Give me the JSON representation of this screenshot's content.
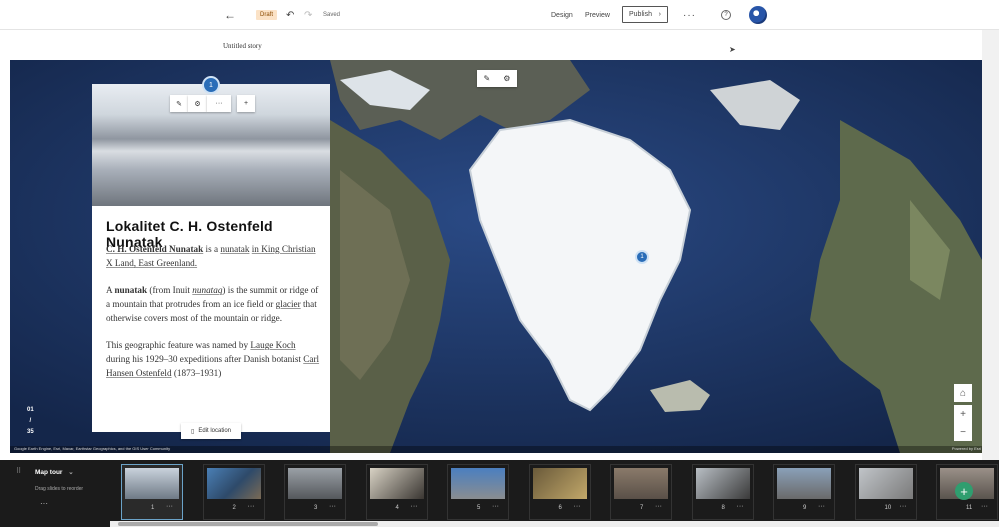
{
  "topbar": {
    "back_icon": "←",
    "status_badge": "Draft",
    "undo_icon": "↶",
    "redo_icon": "↷",
    "saved_label": "Saved",
    "design_label": "Design",
    "preview_label": "Preview",
    "publish_label": "Publish",
    "publish_chevron": "›",
    "more_icon": "···",
    "help_icon": "?"
  },
  "story": {
    "title": "Untitled story"
  },
  "map": {
    "marker_label": "1",
    "edit_location_label": "Edit location",
    "attribution": "Google Earth Engine, Esri, Maxar, Earthstar Geographics, and the GIS User Community",
    "powered_by": "Powered by Esri",
    "home_icon": "⌂",
    "zoom_in": "+",
    "zoom_out": "−",
    "counter": {
      "current": "01",
      "sep": "/",
      "total": "35"
    }
  },
  "card": {
    "badge": "1",
    "title": "Lokalitet C. H. Ostenfeld Nunatak",
    "p1_bold": "C. H. Ostenfeld Nunatak",
    "p1_text": " is a ",
    "p1_link1": "nunatak",
    "p1_link2": "in King Christian X Land, East Greenland.",
    "p2_a": "A ",
    "p2_bold": "nunatak",
    "p2_b": " (from Inuit ",
    "p2_italic": "nunataq",
    "p2_c": ") is the summit or ridge of a mountain that protrudes from an ice field or ",
    "p2_link": "glacier",
    "p2_d": " that otherwise covers most of the mountain or ridge.",
    "p3_a": "This geographic feature was named by ",
    "p3_link1": "Lauge Koch",
    "p3_b": " during his 1929–30 expeditions after Danish botanist ",
    "p3_link2": "Carl Hansen Ostenfeld",
    "p3_c": " (1873–1931)"
  },
  "tour": {
    "label": "Map tour",
    "hint": "Drag slides to reorder",
    "more": "···",
    "slide_more": "···",
    "add_icon": "+",
    "slides": [
      "1",
      "2",
      "3",
      "4",
      "5",
      "6",
      "7",
      "8",
      "9",
      "10",
      "11"
    ]
  }
}
